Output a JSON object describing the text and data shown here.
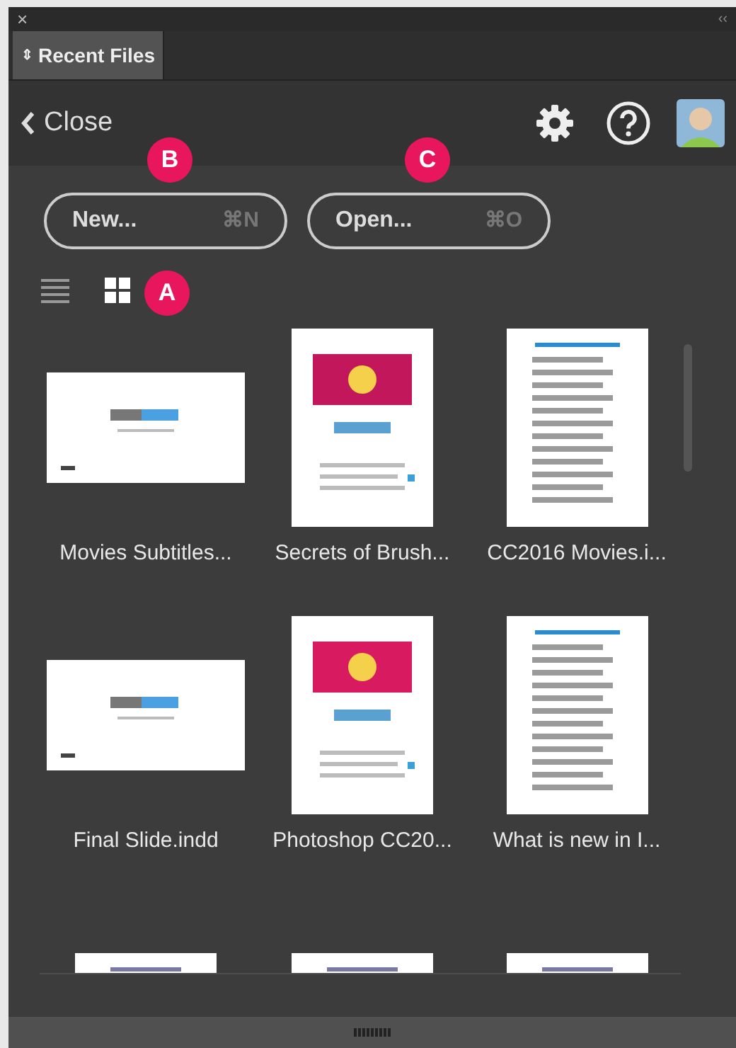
{
  "window": {
    "close": "×",
    "collapse": "‹‹"
  },
  "tabs": [
    {
      "label": "Recent Files",
      "icon": "⇕",
      "selected": true
    }
  ],
  "header": {
    "back": "Close"
  },
  "actions": [
    {
      "label": "New...",
      "shortcut": "⌘N"
    },
    {
      "label": "Open...",
      "shortcut": "⌘O"
    }
  ],
  "views": [
    {
      "kind": "list",
      "selected": false
    },
    {
      "kind": "grid",
      "selected": true
    }
  ],
  "files": [
    {
      "name": "Movies Subtitles...",
      "kind": "picture"
    },
    {
      "name": "Secrets of Brush...",
      "kind": "picture"
    },
    {
      "name": "CC2016 Movies.i...",
      "kind": "picture"
    },
    {
      "name": "Final Slide.indd",
      "kind": "picture"
    },
    {
      "name": "Photoshop CC20...",
      "kind": "picture"
    },
    {
      "name": "What is new in I...",
      "kind": "picture"
    },
    {
      "kind": "picture"
    },
    {
      "kind": "picture"
    },
    {
      "kind": "picture"
    }
  ],
  "annotations": [
    {
      "label": "B"
    },
    {
      "label": "C"
    },
    {
      "label": "A"
    }
  ]
}
